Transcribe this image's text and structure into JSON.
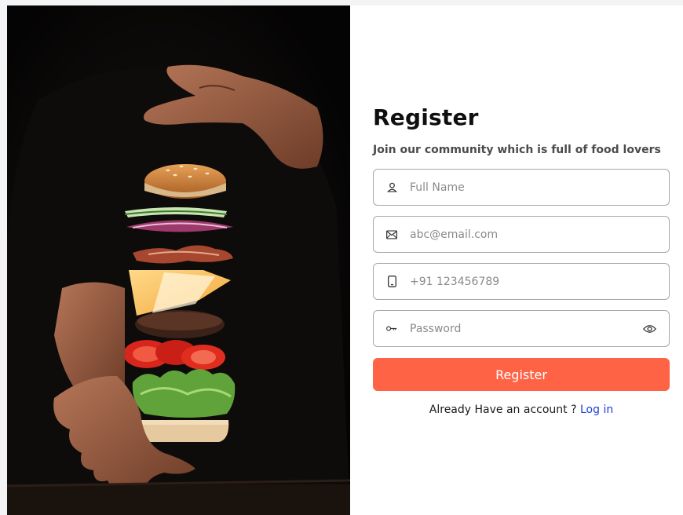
{
  "register": {
    "title": "Register",
    "subtitle": "Join our community which is full of food lovers",
    "fields": {
      "full_name": {
        "placeholder": "Full Name",
        "icon": "user-icon"
      },
      "email": {
        "placeholder": "abc@email.com",
        "icon": "mail-icon"
      },
      "phone": {
        "placeholder": "+91 123456789",
        "icon": "phone-icon"
      },
      "password": {
        "placeholder": "Password",
        "icon": "key-icon",
        "toggle_icon": "eye-icon"
      }
    },
    "submit_label": "Register",
    "footer_text": "Already Have an account ? ",
    "login_link": "Log in"
  },
  "colors": {
    "accent": "#ff6346",
    "link": "#1c3fd6",
    "hero_bg": "#0b0a09"
  }
}
